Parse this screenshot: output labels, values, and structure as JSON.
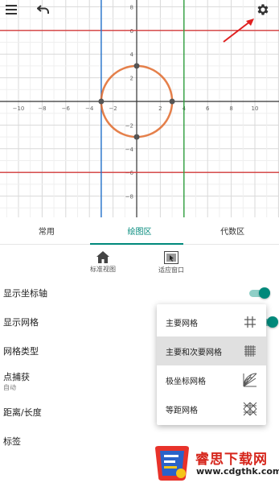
{
  "graph": {
    "x_ticks": [
      "−10",
      "−8",
      "−6",
      "−4",
      "−2",
      "2",
      "4",
      "6",
      "8",
      "10"
    ],
    "y_ticks": [
      "8",
      "6",
      "4",
      "2",
      "−2",
      "−4",
      "−6",
      "−8"
    ],
    "circle_radius": 3,
    "vertical_lines": [
      {
        "x": -3,
        "color": "#1f6fc9"
      },
      {
        "x": 4,
        "color": "#2e9e3c"
      }
    ],
    "horizontal_lines": [
      {
        "y": 6,
        "color": "#d33a3a"
      },
      {
        "y": -6,
        "color": "#d33a3a"
      }
    ],
    "circle_color": "#e06a2c",
    "points": [
      {
        "x": 0,
        "y": 3
      },
      {
        "x": 0,
        "y": -3
      },
      {
        "x": -3,
        "y": 0
      },
      {
        "x": 3,
        "y": 0
      }
    ]
  },
  "toolbar": {
    "menu_icon": "hamburger-menu-icon",
    "undo_icon": "undo-icon",
    "settings_icon": "gear-icon"
  },
  "tabs": [
    {
      "label": "常用"
    },
    {
      "label": "绘图区"
    },
    {
      "label": "代数区"
    }
  ],
  "active_tab": "绘图区",
  "view_buttons": {
    "standard": "标准视图",
    "fit": "适应窗口"
  },
  "settings": {
    "show_axes": "显示坐标轴",
    "show_grid": "显示网格",
    "grid_type": "网格类型",
    "point_capture": "点捕获",
    "point_capture_value": "自动",
    "distance": "距离/长度",
    "labels": "标签"
  },
  "grid_menu": {
    "major": "主要网格",
    "major_minor": "主要和次要网格",
    "polar": "极坐标网格",
    "isometric": "等距网格",
    "selected": "主要和次要网格"
  },
  "watermark": {
    "name": "睿思下载网",
    "url": "www.cdgthk.com"
  },
  "colors": {
    "accent": "#00897b",
    "annotation_arrow": "#e02020"
  }
}
